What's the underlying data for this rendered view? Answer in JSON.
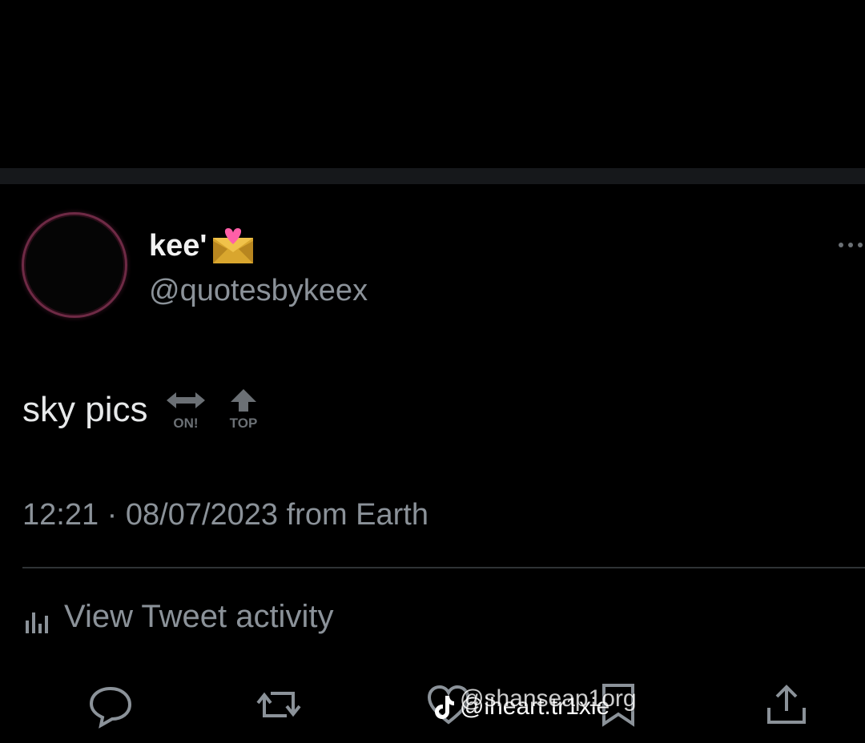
{
  "profile": {
    "display_name": "kee'",
    "handle": "@quotesbykeex"
  },
  "tweet": {
    "text": "sky pics",
    "emoji_labels": [
      "ON!",
      "TOP"
    ],
    "timestamp": "12:21 · 08/07/2023 from Earth"
  },
  "activity": {
    "label": "View Tweet activity"
  },
  "watermark": {
    "line1": "@shanseap1org",
    "line2": "@iheart.tr1xie"
  },
  "icons": {
    "more": "more-icon",
    "badge": "heart-letter-emoji",
    "reply": "reply-icon",
    "retweet": "retweet-icon",
    "like": "like-icon",
    "bookmark": "bookmark-icon",
    "share": "share-icon",
    "tiktok": "tiktok-icon"
  },
  "colors": {
    "background": "#000000",
    "text_primary": "#e7e9ea",
    "text_secondary": "#8b9299",
    "divider": "#2f3336",
    "avatar_ring": "#6e2a45"
  }
}
